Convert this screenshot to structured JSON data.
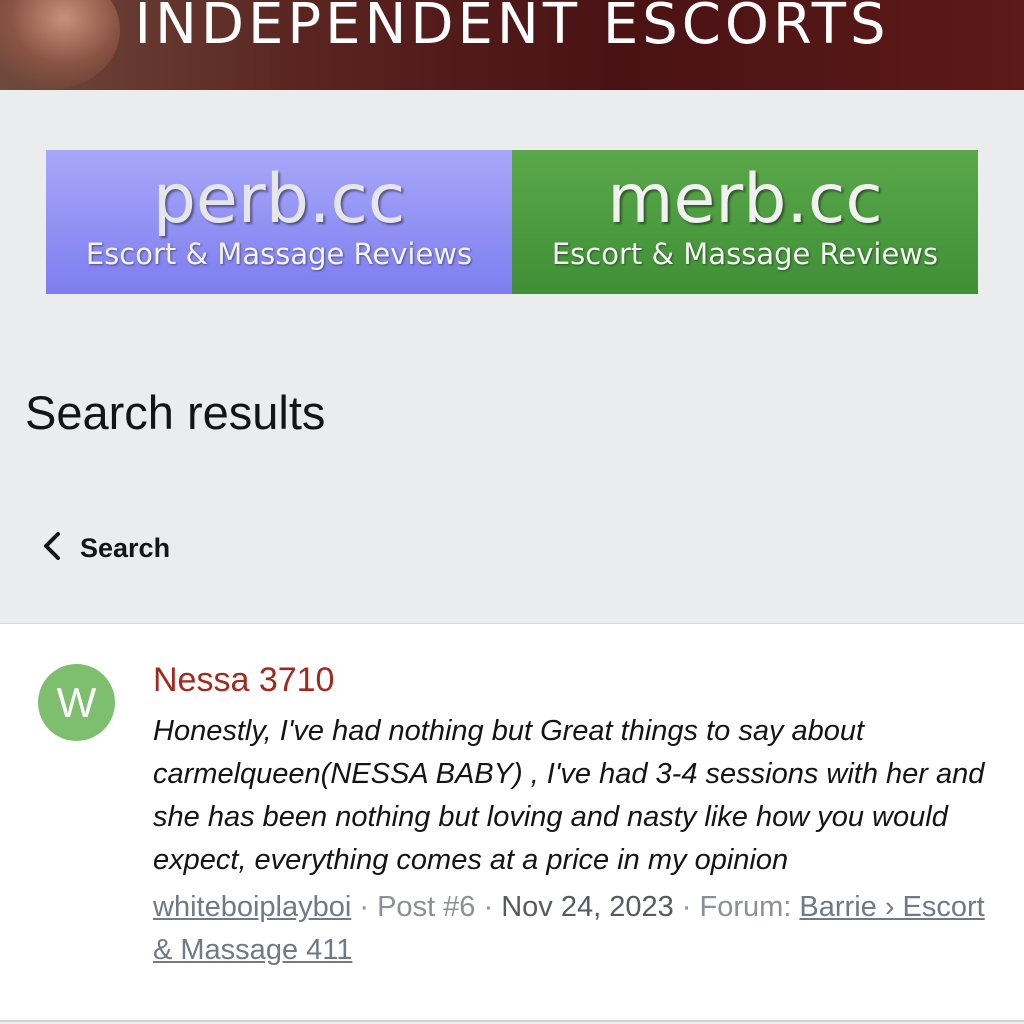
{
  "banner": {
    "title": "INDEPENDENT ESCORTS"
  },
  "ads": [
    {
      "title": "perb.cc",
      "subtitle": "Escort & Massage Reviews"
    },
    {
      "title": "merb.cc",
      "subtitle": "Escort & Massage Reviews"
    }
  ],
  "page_title": "Search results",
  "back": {
    "label": "Search",
    "icon": "chevron-left-icon"
  },
  "result": {
    "avatar_letter": "W",
    "avatar_color": "#7dbf6e",
    "title": "Nessa 3710",
    "snippet": "Honestly, I've had nothing but Great things to say about carmelqueen(NESSA BABY) , I've had 3-4 sessions with her and she has been nothing but loving and nasty like how you would expect, everything comes at a price in my opinion",
    "author": "whiteboiplayboi",
    "post_number": "Post #6",
    "date": "Nov 24, 2023",
    "forum_label": "Forum:",
    "forum": "Barrie › Escort & Massage 411"
  },
  "colors": {
    "title_link": "#a02a1e",
    "perb_bg": "#8a8af4",
    "merb_bg": "#4c9c40"
  }
}
